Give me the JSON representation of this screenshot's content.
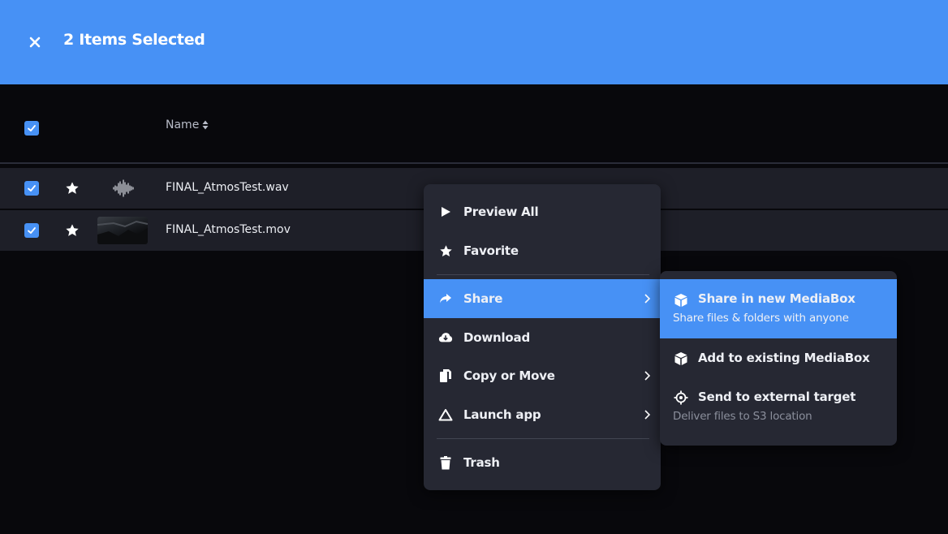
{
  "header": {
    "title": "2 Items Selected",
    "close_icon": "close-icon",
    "accent_color": "#4791f5"
  },
  "table": {
    "columns": [
      {
        "label": "Name",
        "sort_icon": "sort-icon"
      }
    ],
    "rows": [
      {
        "name": "FINAL_AtmosTest.wav",
        "checked": true,
        "favorited": true,
        "thumbnail": "audio-waveform-icon"
      },
      {
        "name": "FINAL_AtmosTest.mov",
        "checked": true,
        "favorited": true,
        "thumbnail": "video-thumbnail"
      }
    ]
  },
  "context_menu": {
    "items": [
      {
        "label": "Preview All",
        "icon": "play-icon"
      },
      {
        "label": "Favorite",
        "icon": "star-icon"
      },
      {
        "label": "Share",
        "icon": "share-icon",
        "has_submenu": true,
        "active": true
      },
      {
        "label": "Download",
        "icon": "cloud-download-icon"
      },
      {
        "label": "Copy or Move",
        "icon": "copy-icon",
        "has_submenu": true
      },
      {
        "label": "Launch app",
        "icon": "launch-app-icon",
        "has_submenu": true
      },
      {
        "label": "Trash",
        "icon": "trash-icon"
      }
    ]
  },
  "share_submenu": {
    "items": [
      {
        "label": "Share in new MediaBox",
        "description": "Share files & folders with anyone",
        "icon": "box-icon",
        "active": true
      },
      {
        "label": "Add to existing MediaBox",
        "description": "",
        "icon": "box-icon"
      },
      {
        "label": "Send to external target",
        "description": "Deliver files to S3 location",
        "icon": "target-icon"
      }
    ]
  }
}
